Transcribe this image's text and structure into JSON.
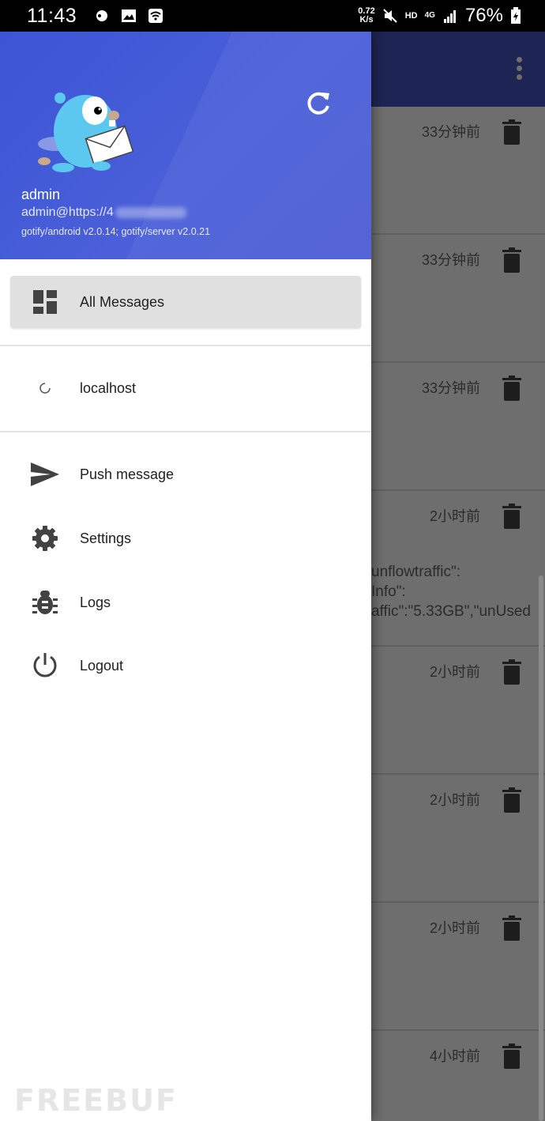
{
  "status_bar": {
    "time": "11:43",
    "speed_value": "0.72",
    "speed_unit": "K/s",
    "hd": "HD",
    "network": "4G",
    "battery": "76%"
  },
  "background": {
    "messages": [
      {
        "time": "33分钟前",
        "body": []
      },
      {
        "time": "33分钟前",
        "body": []
      },
      {
        "time": "33分钟前",
        "body": []
      },
      {
        "time": "2小时前",
        "body": [
          "unflowtraffic\":",
          "Info\":",
          "affic\":\"5.33GB\",\"unUsed"
        ]
      },
      {
        "time": "2小时前",
        "body": []
      },
      {
        "time": "2小时前",
        "body": []
      },
      {
        "time": "2小时前",
        "body": []
      },
      {
        "time": "4小时前",
        "body": []
      }
    ]
  },
  "drawer": {
    "header": {
      "username": "admin",
      "email_prefix": "admin@https://4",
      "version": "gotify/android v2.0.14; gotify/server v2.0.21"
    },
    "nav": {
      "all_messages": "All Messages",
      "localhost": "localhost",
      "push_message": "Push message",
      "settings": "Settings",
      "logs": "Logs",
      "logout": "Logout"
    }
  },
  "watermark": "FREEBUF",
  "colors": {
    "header_blue": "#3f56d6",
    "appbar": "#1e2453",
    "selected_bg": "#e0e0e0"
  }
}
